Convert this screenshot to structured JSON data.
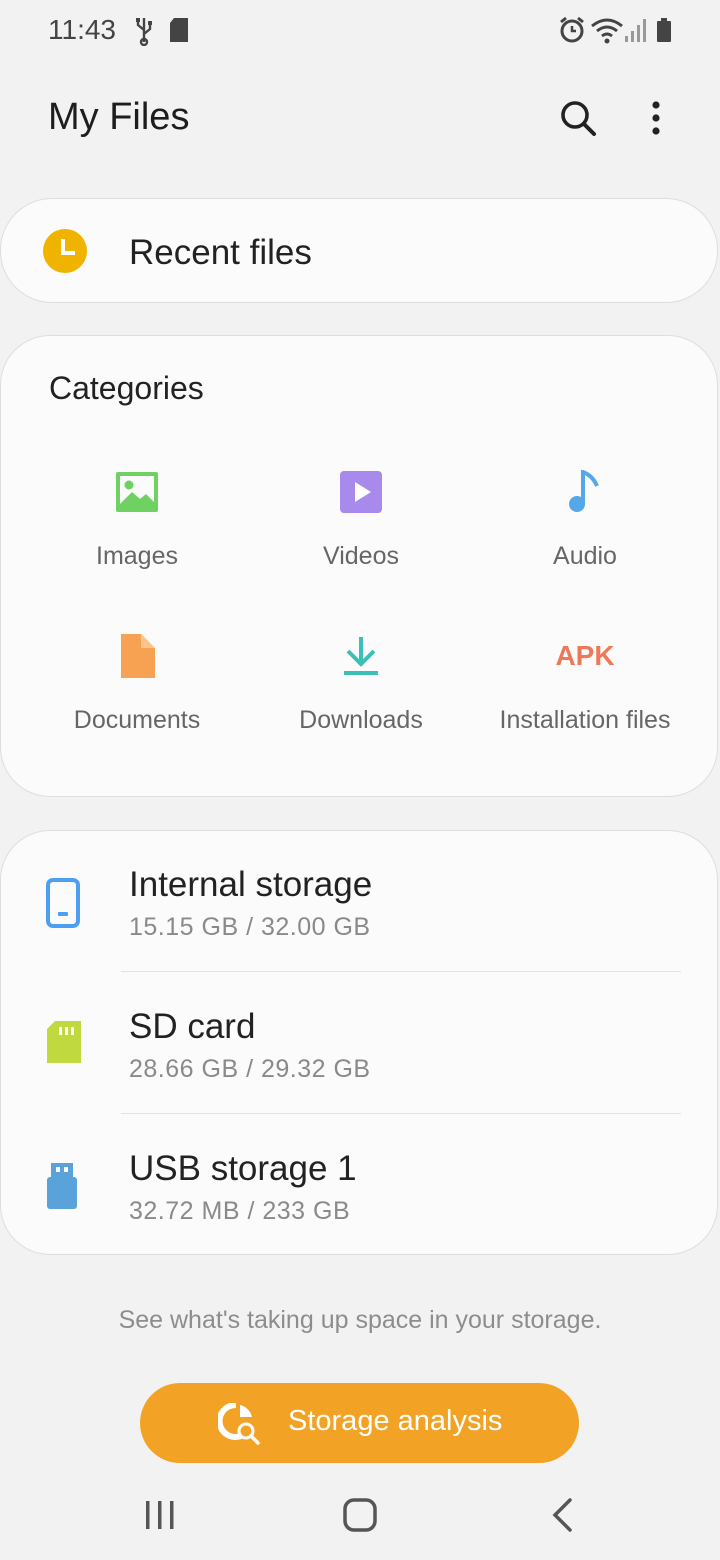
{
  "status_bar": {
    "time": "11:43",
    "left_icons": [
      "usb-icon",
      "sd-card-icon"
    ],
    "right_icons": [
      "alarm-icon",
      "wifi-icon",
      "signal-icon",
      "battery-icon"
    ]
  },
  "header": {
    "title": "My Files",
    "actions": [
      "search-icon",
      "more-options-icon"
    ]
  },
  "recent": {
    "label": "Recent files",
    "icon": "clock-icon",
    "icon_color": "#f0b400"
  },
  "categories": {
    "title": "Categories",
    "items": [
      {
        "label": "Images",
        "icon": "image-icon",
        "color": "#6fd161"
      },
      {
        "label": "Videos",
        "icon": "video-icon",
        "color": "#a889ec"
      },
      {
        "label": "Audio",
        "icon": "music-note-icon",
        "color": "#56a7e8"
      },
      {
        "label": "Documents",
        "icon": "document-icon",
        "color": "#f7a253"
      },
      {
        "label": "Downloads",
        "icon": "download-icon",
        "color": "#3cc0b6"
      },
      {
        "label": "Installation files",
        "icon": "apk-icon",
        "icon_text": "APK",
        "color": "#ef7858"
      }
    ]
  },
  "storage": {
    "items": [
      {
        "name": "Internal storage",
        "size": "15.15 GB / 32.00 GB",
        "icon": "phone-icon",
        "color": "#4d9ff1"
      },
      {
        "name": "SD card",
        "size": "28.66 GB / 29.32 GB",
        "icon": "sd-card-icon",
        "color": "#bfd93e"
      },
      {
        "name": "USB storage 1",
        "size": "32.72 MB / 233 GB",
        "icon": "usb-drive-icon",
        "color": "#5aa3da"
      }
    ]
  },
  "analysis": {
    "hint": "See what's taking up space in your storage.",
    "button_label": "Storage analysis",
    "button_color": "#f2a325"
  },
  "nav_bar": {
    "buttons": [
      "recent-apps-icon",
      "home-icon",
      "back-icon"
    ]
  }
}
